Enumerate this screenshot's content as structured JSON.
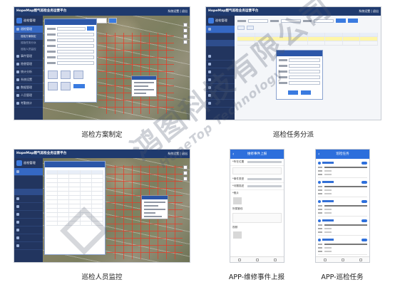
{
  "app": {
    "title": "HopeMap燃气巡检业务运营平台",
    "window_controls": "系统设置 | 退出",
    "logo_text": "巡检管理"
  },
  "panels": [
    {
      "caption": "巡检方案制定",
      "sidebar": [
        "巡检管理",
        "巡检方案制定",
        "巡检任务分派",
        "巡检人员监控",
        "事件管理",
        "隐患管理",
        "统计分析",
        "系统设置",
        "数据管理",
        "人员管理",
        "考勤统计"
      ]
    },
    {
      "caption": "巡检任务分派"
    },
    {
      "caption": "巡检人员监控"
    },
    {
      "caption": "APP-维修事件上报",
      "header": "维修事件上报",
      "fields": [
        "*所在位置",
        "*事件类型",
        "*问题描述",
        "*照片",
        "所属管线",
        "视频"
      ]
    },
    {
      "caption": "APP-巡检任务",
      "header": "巡检任务",
      "tasks": [
        {
          "tag": "巡检"
        },
        {
          "tag": "巡检"
        },
        {
          "tag": "巡检"
        },
        {
          "tag": "巡检"
        },
        {
          "tag": "巡检"
        },
        {
          "tag": "巡检"
        }
      ]
    }
  ],
  "watermark": {
    "chinese": "鸿图科技有限公司",
    "english": "HopeTop Technology"
  },
  "colors": {
    "titlebar": "#1f3a6e",
    "sidebar": "#22355f",
    "accent": "#3568c4",
    "phone_header": "#2d6fdc",
    "road": "#e63c28"
  }
}
